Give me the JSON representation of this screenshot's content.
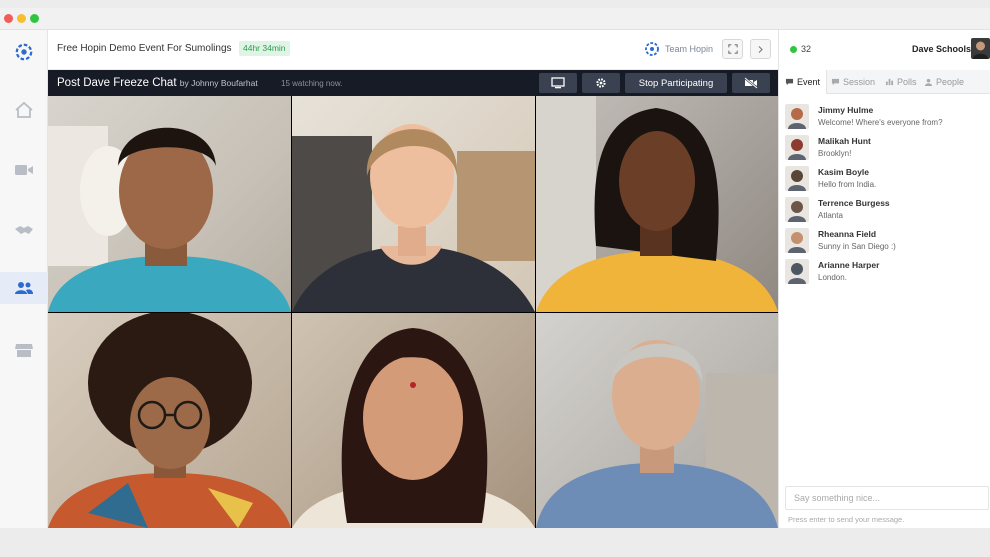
{
  "window": {
    "traffic_lights": [
      "close",
      "minimize",
      "zoom"
    ]
  },
  "sidebar": {
    "items": [
      {
        "name": "home",
        "icon": "home-icon"
      },
      {
        "name": "stage",
        "icon": "video-camera-icon"
      },
      {
        "name": "networking",
        "icon": "handshake-icon"
      },
      {
        "name": "sessions",
        "icon": "people-icon",
        "active": true
      },
      {
        "name": "expo",
        "icon": "storefront-icon"
      }
    ]
  },
  "topbar": {
    "event_title": "Free Hopin Demo Event For Sumolings",
    "time_left": "44hr 34min",
    "team_name": "Team Hopin",
    "fullscreen_icon": "expand-icon",
    "collapse_icon": "chevron-right-icon"
  },
  "stage": {
    "title": "Post Dave Freeze Chat",
    "by": "by Johnny Boufarhat",
    "watching": "15 watching now.",
    "share_icon": "screen-share-icon",
    "settings_icon": "gear-icon",
    "stop_label": "Stop Participating",
    "camera_icon": "camera-off-icon"
  },
  "participants": [
    {
      "name": "participant-1"
    },
    {
      "name": "participant-2"
    },
    {
      "name": "participant-3"
    },
    {
      "name": "participant-4"
    },
    {
      "name": "participant-5"
    },
    {
      "name": "participant-6"
    }
  ],
  "header_right": {
    "online_count": "32",
    "user_name": "Dave Schools"
  },
  "tabs": [
    {
      "label": "Event",
      "icon": "chat-bubble-icon"
    },
    {
      "label": "Session",
      "icon": "chat-bubble-icon"
    },
    {
      "label": "Polls",
      "icon": "poll-icon"
    },
    {
      "label": "People",
      "icon": "person-icon"
    }
  ],
  "chat": [
    {
      "name": "Jimmy Hulme",
      "message": "Welcome! Where's everyone from?",
      "color": "#b56a4a"
    },
    {
      "name": "Malikah Hunt",
      "message": "Brooklyn!",
      "color": "#8c3b2e"
    },
    {
      "name": "Kasim Boyle",
      "message": "Hello from India.",
      "color": "#5a4636"
    },
    {
      "name": "Terrence Burgess",
      "message": "Atlanta",
      "color": "#6b5647"
    },
    {
      "name": "Rheanna Field",
      "message": "Sunny in San Diego :)",
      "color": "#c4906d"
    },
    {
      "name": "Arianne Harper",
      "message": "London.",
      "color": "#4e5661"
    }
  ],
  "chat_input": {
    "placeholder": "Say something nice...",
    "hint": "Press enter to send your message."
  },
  "colors": {
    "stage_bar": "#161b26",
    "accent": "#2c6bd0",
    "online": "#2fc540"
  }
}
